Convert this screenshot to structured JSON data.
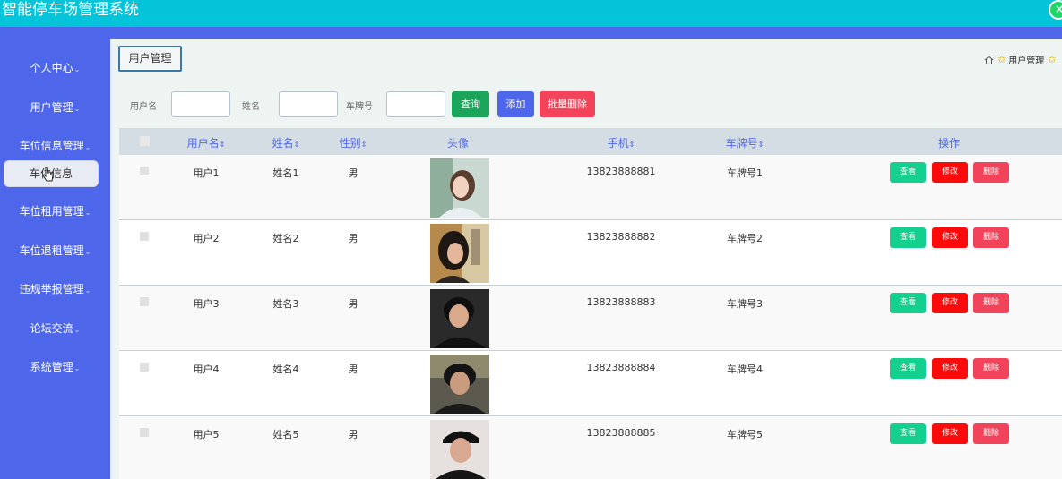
{
  "app": {
    "title": "智能停车场管理系统",
    "close_glyph": "×"
  },
  "sidebar": {
    "items": [
      {
        "label": "个人中心"
      },
      {
        "label": "用户管理"
      },
      {
        "label": "车位信息管理"
      },
      {
        "label": "车位租用管理"
      },
      {
        "label": "车位退租管理"
      },
      {
        "label": "违规举报管理"
      },
      {
        "label": "论坛交流"
      },
      {
        "label": "系统管理"
      }
    ],
    "active_sub": "车位信息",
    "caret_glyph": "⌄"
  },
  "main": {
    "tab": "用户管理",
    "breadcrumb": {
      "current": "用户管理"
    }
  },
  "search": {
    "username_label": "用户名",
    "name_label": "姓名",
    "plate_label": "车牌号",
    "username_value": "",
    "name_value": "",
    "plate_value": "",
    "query_button": "查询",
    "add_button": "添加",
    "batch_delete_button": "批量删除"
  },
  "table": {
    "headers": {
      "username": "用户名",
      "name": "姓名",
      "gender": "性别",
      "avatar": "头像",
      "phone": "手机",
      "plate": "车牌号",
      "actions": "操作"
    },
    "sort_glyph": "⇕",
    "rows": [
      {
        "username": "用户1",
        "name": "姓名1",
        "gender": "男",
        "phone": "13823888881",
        "plate": "车牌号1"
      },
      {
        "username": "用户2",
        "name": "姓名2",
        "gender": "男",
        "phone": "13823888882",
        "plate": "车牌号2"
      },
      {
        "username": "用户3",
        "name": "姓名3",
        "gender": "男",
        "phone": "13823888883",
        "plate": "车牌号3"
      },
      {
        "username": "用户4",
        "name": "姓名4",
        "gender": "男",
        "phone": "13823888884",
        "plate": "车牌号4"
      },
      {
        "username": "用户5",
        "name": "姓名5",
        "gender": "男",
        "phone": "13823888885",
        "plate": "车牌号5"
      }
    ],
    "actions": {
      "view": "查看",
      "edit": "修改",
      "delete": "删除"
    }
  },
  "colors": {
    "header_bg": "#03c4d8",
    "sidebar_bg": "#4e67ea",
    "query": "#1aa55a",
    "add": "#4e67ea",
    "batch_delete": "#f3435a",
    "view": "#14d08e",
    "edit": "#ff0a0a",
    "delete": "#f3435a"
  }
}
